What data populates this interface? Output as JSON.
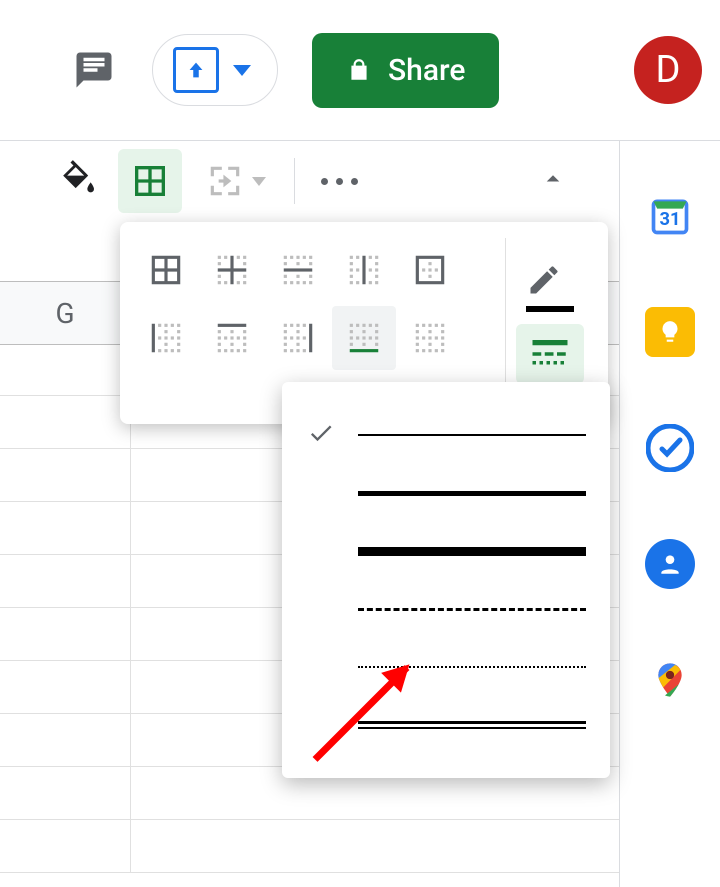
{
  "header": {
    "share_label": "Share",
    "avatar_initial": "D"
  },
  "toolbar": {
    "tooltip_fill": "Fill color",
    "tooltip_borders": "Borders",
    "tooltip_merge": "Merge cells",
    "tooltip_more": "More"
  },
  "borders_popover": {
    "icons": [
      "border-all",
      "border-inner",
      "border-horizontal",
      "border-vertical",
      "border-outer",
      "border-left",
      "border-top",
      "border-right",
      "border-bottom",
      "border-clear"
    ],
    "selected": "border-bottom",
    "style_button": "border-style"
  },
  "border_style_menu": {
    "selected_index": 0,
    "styles": [
      "thin-solid",
      "medium-solid",
      "thick-solid",
      "dashed",
      "dotted",
      "double"
    ]
  },
  "columns": [
    "G"
  ],
  "side_panel": {
    "calendar_day": "31"
  }
}
